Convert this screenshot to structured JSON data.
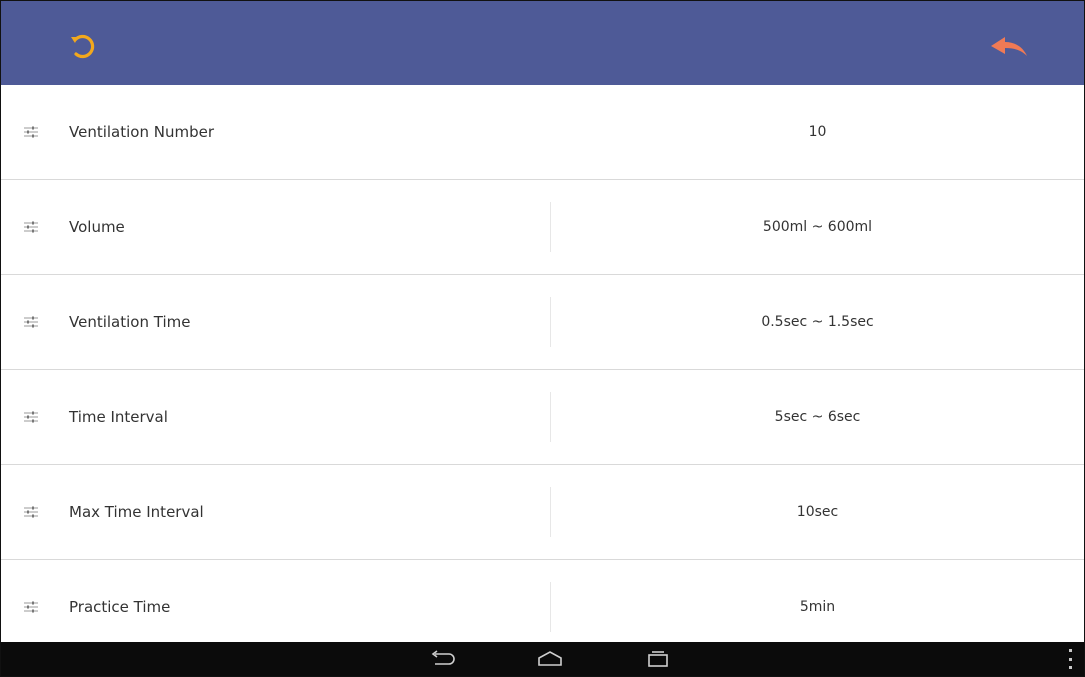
{
  "header": {
    "refresh_icon": "refresh-icon",
    "back_icon": "back-arrow-icon",
    "refresh_color": "#f2a81d",
    "back_color": "#f07a55",
    "bar_color": "#4e5a97"
  },
  "settings": [
    {
      "label": "Ventilation Number",
      "value": "10"
    },
    {
      "label": "Volume",
      "value": "500ml ~ 600ml"
    },
    {
      "label": "Ventilation Time",
      "value": "0.5sec ~ 1.5sec"
    },
    {
      "label": "Time Interval",
      "value": "5sec ~ 6sec"
    },
    {
      "label": "Max Time Interval",
      "value": "10sec"
    },
    {
      "label": "Practice Time",
      "value": "5min"
    }
  ],
  "navbar": {
    "icons": [
      "back-icon",
      "home-icon",
      "recent-apps-icon",
      "menu-icon"
    ]
  }
}
